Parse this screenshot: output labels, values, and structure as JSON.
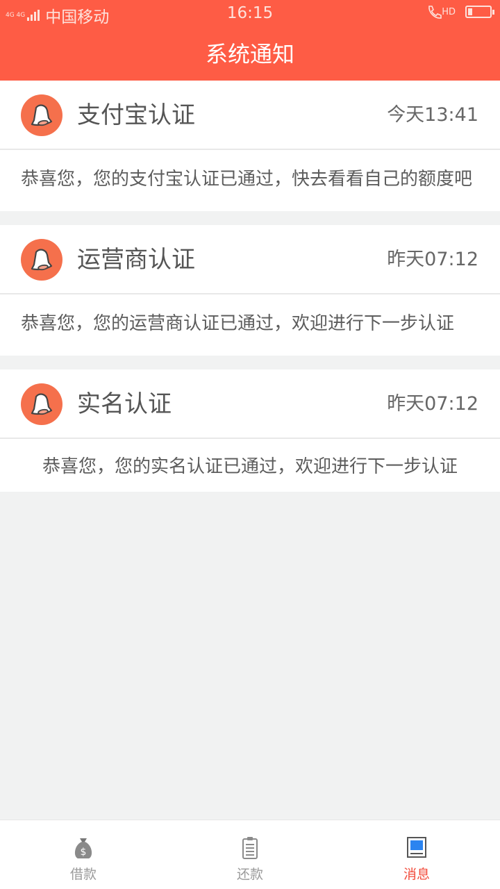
{
  "status_bar": {
    "network": "4G 4G",
    "carrier": "中国移动",
    "time": "16:15",
    "hd": "HD"
  },
  "header": {
    "title": "系统通知"
  },
  "notifications": [
    {
      "icon": "bell-icon",
      "title": "支付宝认证",
      "time": "今天13:41",
      "message": "恭喜您，您的支付宝认证已通过，快去看看自己的额度吧"
    },
    {
      "icon": "bell-icon",
      "title": "运营商认证",
      "time": "昨天07:12",
      "message": "恭喜您，您的运营商认证已通过，欢迎进行下一步认证"
    },
    {
      "icon": "bell-icon",
      "title": "实名认证",
      "time": "昨天07:12",
      "message": "恭喜您，您的实名认证已通过，欢迎进行下一步认证"
    }
  ],
  "tab_bar": {
    "items": [
      {
        "label": "借款",
        "icon": "money-bag-icon",
        "active": false
      },
      {
        "label": "还款",
        "icon": "clipboard-icon",
        "active": false
      },
      {
        "label": "消息",
        "icon": "message-icon",
        "active": true
      }
    ]
  },
  "colors": {
    "brand": "#fe5c45",
    "accent": "#f24b3b",
    "icon_bg": "#f5704c",
    "background": "#f1f2f2"
  }
}
